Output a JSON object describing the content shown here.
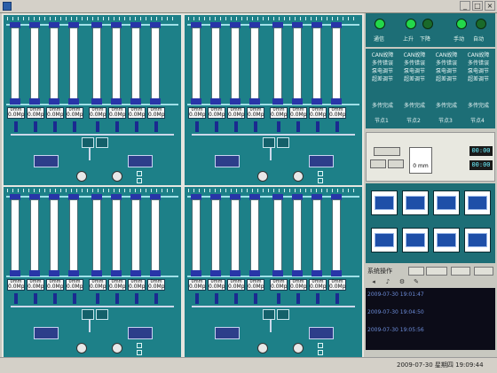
{
  "window": {
    "title": ""
  },
  "quadrants": [
    {
      "id": "q1",
      "pump_label": "",
      "checks": [
        "",
        ""
      ]
    },
    {
      "id": "q2",
      "pump_label": "",
      "checks": [
        "",
        ""
      ]
    },
    {
      "id": "q3",
      "pump_label": "",
      "checks": [
        "",
        ""
      ]
    },
    {
      "id": "q4",
      "pump_label": "",
      "checks": [
        "",
        ""
      ]
    }
  ],
  "gauge": {
    "label": "0mm",
    "value": "0.0Mp"
  },
  "controls": {
    "comm": "通信",
    "up": "上升",
    "down": "下降",
    "manual": "手动",
    "auto": "自动",
    "lamp_colors": {
      "green": "#23d84a",
      "dim": "#1a6a2a"
    }
  },
  "faults": {
    "items": [
      [
        "CAN故障",
        "多传错误",
        "泵电调节",
        "超差调节"
      ],
      [
        "CAN故障",
        "多传错误",
        "泵电调节",
        "超差调节"
      ],
      [
        "CAN故障",
        "多传错误",
        "泵电调节",
        "超差调节"
      ],
      [
        "CAN故障",
        "多传错误",
        "泵电调节",
        "超差调节"
      ]
    ],
    "done": [
      "多传完成",
      "多传完成",
      "多传完成",
      "多传完成"
    ],
    "nodes": [
      "节点1",
      "节点2",
      "节点3",
      "节点4"
    ]
  },
  "info": {
    "btn1": "",
    "btn2": "",
    "btn3": "",
    "max_height": "",
    "max_value": "0 mm",
    "timer_label": "",
    "step_time": "",
    "loop_time": "",
    "step_digits": "00:00",
    "loop_digits": "00:00"
  },
  "operations": [
    "",
    "",
    "",
    "",
    "",
    "",
    "",
    ""
  ],
  "system": {
    "label": "系统操作",
    "b1": "",
    "b2": "",
    "b3": "",
    "b4": ""
  },
  "log": [
    {
      "time": "2009-07-30 19:01:47",
      "msg": ""
    },
    {
      "time": "2009-07-30 19:04:50",
      "msg": ""
    },
    {
      "time": "2009-07-30 19:05:56",
      "msg": ""
    }
  ],
  "statusbar": {
    "steps": [
      "",
      "",
      "",
      "",
      "",
      ""
    ],
    "datetime": "2009-07-30  星期四   19:09:44"
  }
}
